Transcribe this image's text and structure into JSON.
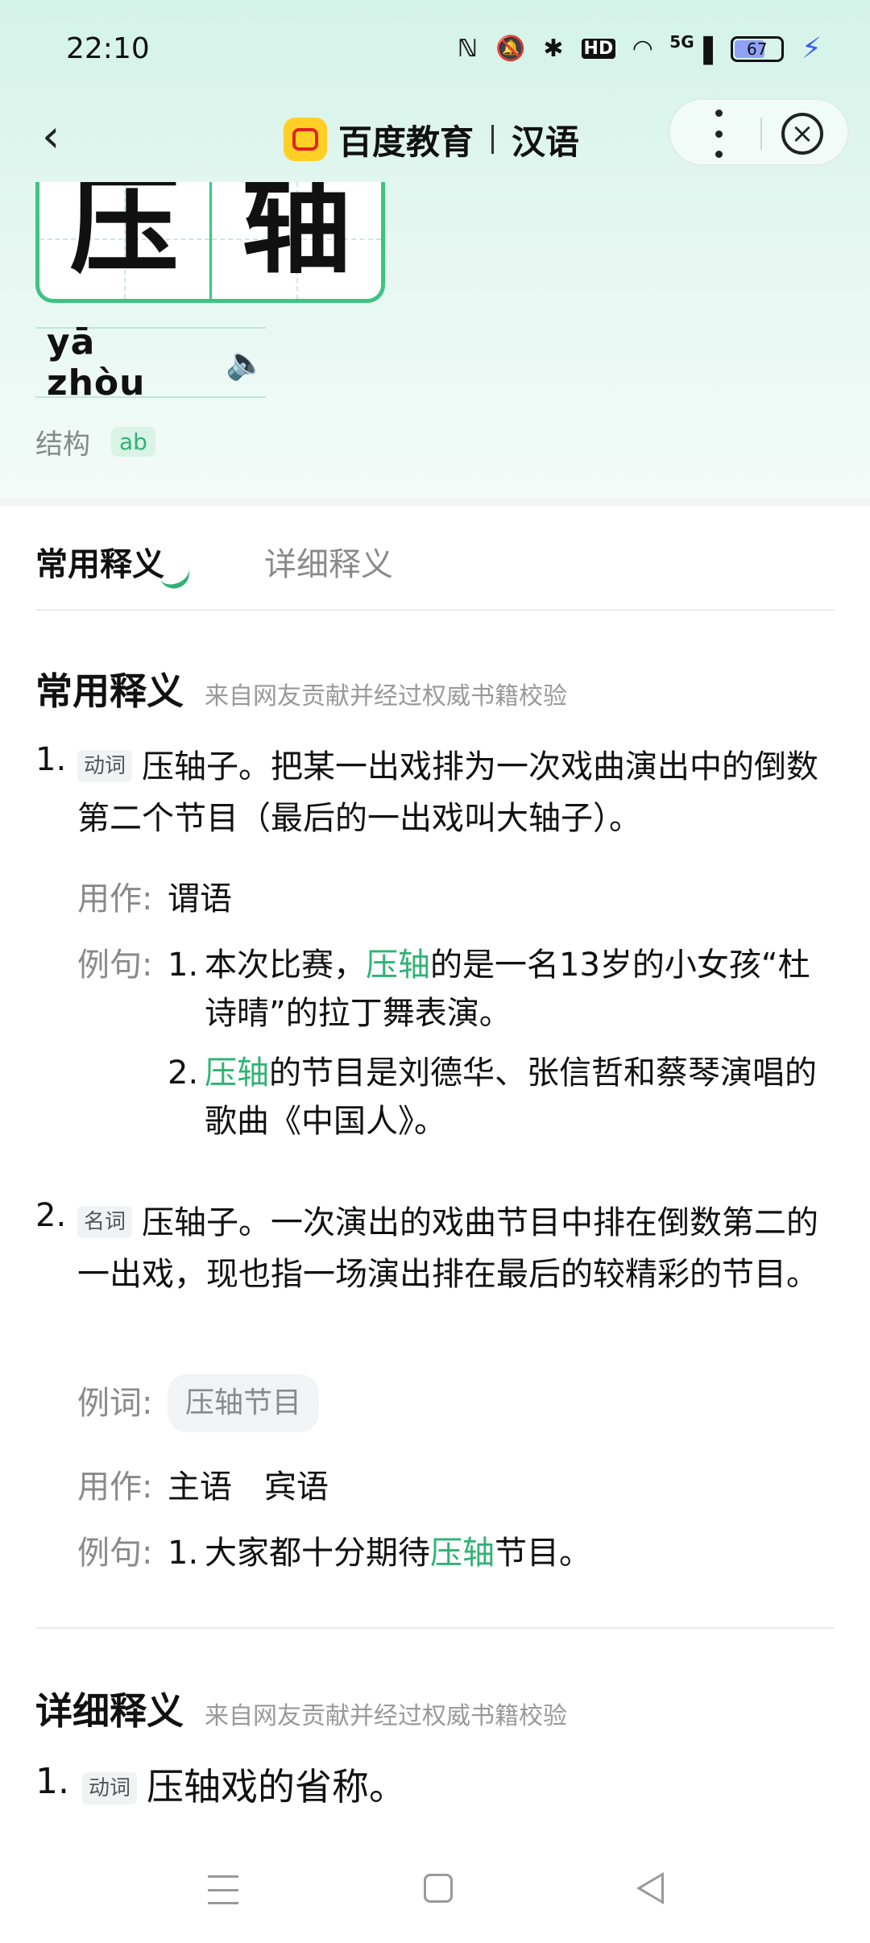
{
  "status_bar": {
    "time": "22:10",
    "icons": [
      "nfc-icon",
      "mute-icon",
      "bluetooth-icon",
      "hd-icon",
      "wifi-icon",
      "signal-5g-icon"
    ],
    "hd_label": "HD",
    "net_label": "5G",
    "battery": "67"
  },
  "navbar": {
    "brand_name": "百度教育",
    "brand_sub": "汉语",
    "accent_color": "#3ec383"
  },
  "word": {
    "chars": [
      "压",
      "轴"
    ],
    "pinyin": "yā  zhòu",
    "structure_label": "结构",
    "structure_value": "ab"
  },
  "tabs": [
    "常用释义",
    "详细释义"
  ],
  "common": {
    "title": "常用释义",
    "source": "来自网友贡献并经过权威书籍校验",
    "definitions": [
      {
        "num": "1.",
        "pos": "动词",
        "text": "压轴子。把某一出戏排为一次戏曲演出中的倒数第二个节目（最后的一出戏叫大轴子）。",
        "usage_label": "用作:",
        "usage": "谓语",
        "examples_label": "例句:",
        "examples": [
          {
            "num": "1.",
            "pre": "本次比赛，",
            "hl": "压轴",
            "post": "的是一名13岁的小女孩“杜诗晴”的拉丁舞表演。"
          },
          {
            "num": "2.",
            "pre": "",
            "hl": "压轴",
            "post": "的节目是刘德华、张信哲和蔡琴演唱的歌曲《中国人》。"
          }
        ]
      },
      {
        "num": "2.",
        "pos": "名词",
        "text": "压轴子。一次演出的戏曲节目中排在倒数第二的一出戏，现也指一场演出排在最后的较精彩的节目。",
        "words_label": "例词:",
        "word_chip": "压轴节目",
        "usage_label": "用作:",
        "usage": "主语　宾语",
        "examples_label": "例句:",
        "examples": [
          {
            "num": "1.",
            "pre": "大家都十分期待",
            "hl": "压轴",
            "post": "节目。"
          }
        ]
      }
    ]
  },
  "detailed": {
    "title": "详细释义",
    "source": "来自网友贡献并经过权威书籍校验",
    "first": {
      "num": "1.",
      "pos": "动词",
      "text": "压轴戏的省称。"
    }
  }
}
